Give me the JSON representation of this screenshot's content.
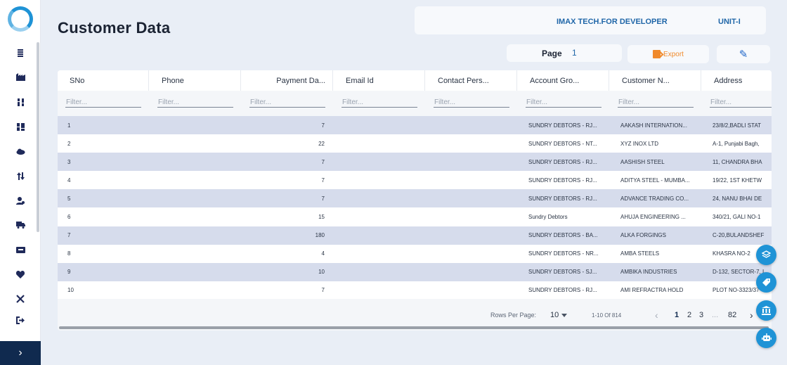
{
  "sidebar": {
    "icons": [
      "menu-list-icon",
      "factory-icon",
      "tools-icon",
      "warehouse-icon",
      "cloud-icon",
      "transfer-icon",
      "user-gear-icon",
      "truck-icon",
      "badge-icon",
      "heart-icon",
      "wrench-icon",
      "logout-icon"
    ],
    "toggle": "›"
  },
  "header": {
    "title": "Customer Data",
    "company": "IMAX TECH.FOR DEVELOPER",
    "unit": "UNIT-I"
  },
  "toolbar": {
    "page_label": "Page",
    "page_value": "1",
    "export_label": "Export",
    "edit_glyph": "✎"
  },
  "table": {
    "columns": [
      "SNo",
      "Phone",
      "Payment Da...",
      "Email Id",
      "Contact Pers...",
      "Account Gro...",
      "Customer N...",
      "Address"
    ],
    "filter_placeholder": "Filter...",
    "rows": [
      {
        "sno": "1",
        "phone": "",
        "payment": "7",
        "email": "",
        "contact": "",
        "account": "SUNDRY DEBTORS - RJ...",
        "customer": "AAKASH INTERNATION...",
        "address": "23/8/2,BADLI STAT"
      },
      {
        "sno": "2",
        "phone": "",
        "payment": "22",
        "email": "",
        "contact": "",
        "account": "SUNDRY DEBTORS - NT...",
        "customer": "XYZ INOX LTD",
        "address": "A-1, Punjabi Bagh,"
      },
      {
        "sno": "3",
        "phone": "",
        "payment": "7",
        "email": "",
        "contact": "",
        "account": "SUNDRY DEBTORS - RJ...",
        "customer": "AASHISH STEEL",
        "address": "11, CHANDRA BHA"
      },
      {
        "sno": "4",
        "phone": "",
        "payment": "7",
        "email": "",
        "contact": "",
        "account": "SUNDRY DEBTORS - RJ...",
        "customer": "ADITYA STEEL - MUMBA...",
        "address": "19/22, 1ST KHETW"
      },
      {
        "sno": "5",
        "phone": "",
        "payment": "7",
        "email": "",
        "contact": "",
        "account": "SUNDRY DEBTORS - RJ...",
        "customer": "ADVANCE TRADING CO...",
        "address": "24, NANU BHAI DE"
      },
      {
        "sno": "6",
        "phone": "",
        "payment": "15",
        "email": "",
        "contact": "",
        "account": "Sundry Debtors",
        "customer": "AHUJA ENGINEERING ...",
        "address": "340/21, GALI NO-1"
      },
      {
        "sno": "7",
        "phone": "",
        "payment": "180",
        "email": "",
        "contact": "",
        "account": "SUNDRY DEBTORS - BA...",
        "customer": "ALKA FORGINGS",
        "address": "C-20,BULANDSHEF"
      },
      {
        "sno": "8",
        "phone": "",
        "payment": "4",
        "email": "",
        "contact": "",
        "account": "SUNDRY DEBTORS - NR...",
        "customer": "AMBA STEELS",
        "address": "KHASRA NO-2"
      },
      {
        "sno": "9",
        "phone": "",
        "payment": "10",
        "email": "",
        "contact": "",
        "account": "SUNDRY DEBTORS - SJ...",
        "customer": "AMBIKA INDUSTRIES",
        "address": "D-132, SECTOR-7, I"
      },
      {
        "sno": "10",
        "phone": "",
        "payment": "7",
        "email": "",
        "contact": "",
        "account": "SUNDRY DEBTORS - RJ...",
        "customer": "AMI REFRACTRA HOLD",
        "address": "PLOT NO-3323/37"
      }
    ]
  },
  "pagination": {
    "rows_per_page_label": "Rows Per Page:",
    "rows_per_page": "10",
    "range": "1-10 Of 814",
    "prev": "‹",
    "pages": [
      "1",
      "2",
      "3"
    ],
    "ellipsis": "...",
    "last": "82",
    "next": "›"
  },
  "fabs": [
    "layers-icon",
    "tag-icon",
    "bank-icon",
    "robot-icon"
  ],
  "colors": {
    "accent": "#1f93d6",
    "sidebar_toggle": "#102a4f",
    "export": "#f08a2b",
    "row_alt": "#d6dcec",
    "link": "#1f66a8"
  }
}
